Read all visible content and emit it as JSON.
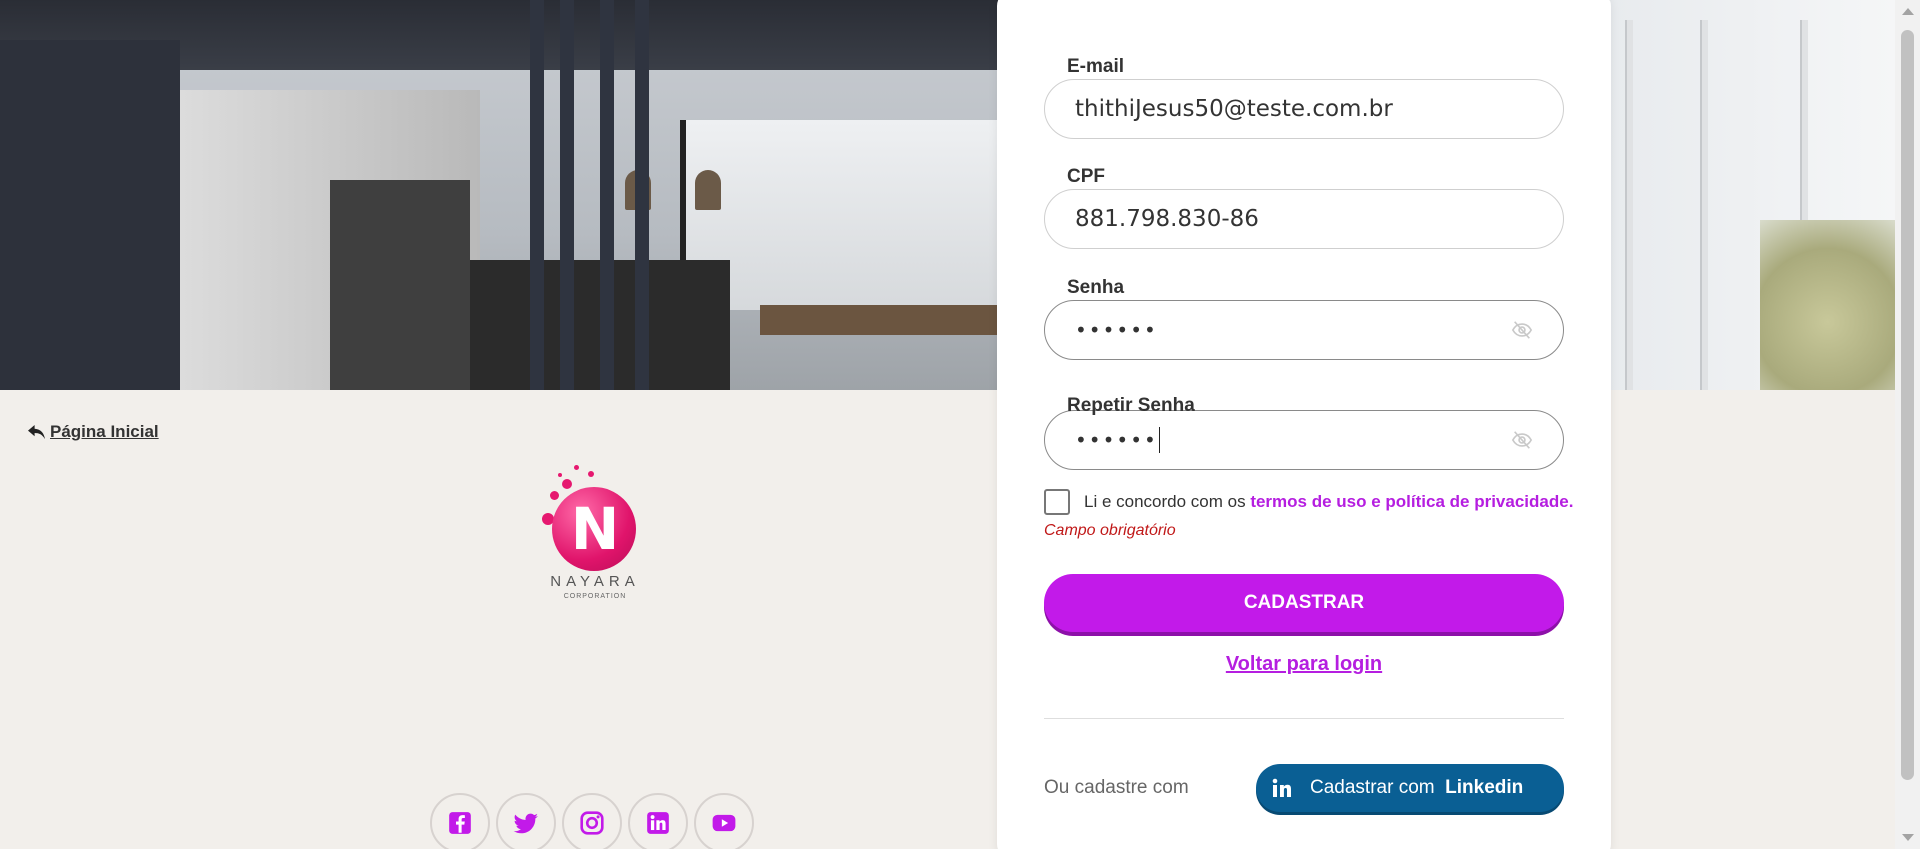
{
  "nav": {
    "back_label": "Página Inicial"
  },
  "brand": {
    "logo_letter": "N",
    "name": "NAYARA",
    "tagline": "CORPORATION",
    "accent_color": "#c21ae9",
    "logo_color": "#e0146b"
  },
  "form": {
    "email": {
      "label": "E-mail",
      "value": "thithiJesus50@teste.com.br"
    },
    "cpf": {
      "label": "CPF",
      "value": "881.798.830-86"
    },
    "password": {
      "label": "Senha",
      "value": "••••••"
    },
    "repeat_password": {
      "label": "Repetir Senha",
      "value": "••••••"
    },
    "terms": {
      "prefix": "Li e concordo com os ",
      "link": "termos de uso e política de privacidade.",
      "checked": false
    },
    "error": "Campo obrigatório",
    "submit_label": "CADASTRAR",
    "login_link": "Voltar para login",
    "alt_signup_text": "Ou cadastre com",
    "linkedin": {
      "prefix": "Cadastrar com",
      "brand": "Linkedin",
      "color": "#0a5f94"
    }
  },
  "social": [
    {
      "name": "facebook-icon"
    },
    {
      "name": "twitter-icon"
    },
    {
      "name": "instagram-icon"
    },
    {
      "name": "linkedin-icon"
    },
    {
      "name": "youtube-icon"
    }
  ]
}
